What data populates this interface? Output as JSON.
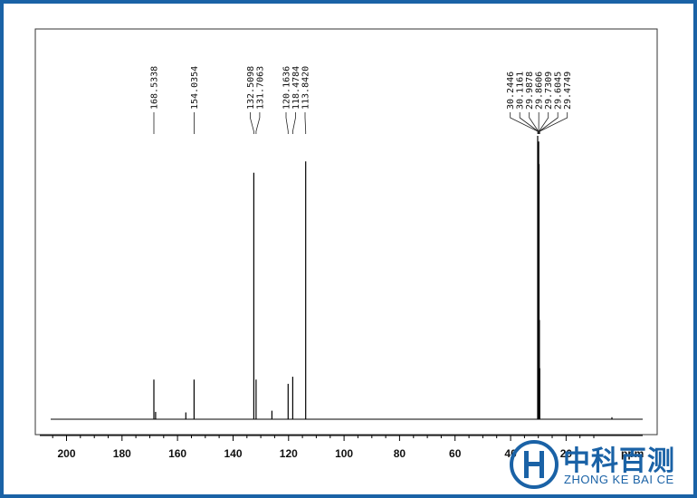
{
  "chart_data": {
    "type": "line",
    "title": "",
    "xlabel": "ppm",
    "ylabel": "",
    "x_reversed": true,
    "xlim": [
      206,
      0
    ],
    "ylim": [
      0,
      100
    ],
    "x_ticks": [
      200,
      180,
      160,
      140,
      120,
      100,
      80,
      60,
      40,
      20
    ],
    "peaks": [
      {
        "x": 168.53,
        "y": 14.0
      },
      {
        "x": 167.9,
        "y": 2.6
      },
      {
        "x": 157.0,
        "y": 2.4
      },
      {
        "x": 154.04,
        "y": 14.0
      },
      {
        "x": 132.51,
        "y": 87.0
      },
      {
        "x": 131.71,
        "y": 14.0
      },
      {
        "x": 126.0,
        "y": 3.0
      },
      {
        "x": 120.16,
        "y": 12.5
      },
      {
        "x": 118.48,
        "y": 15.0
      },
      {
        "x": 113.84,
        "y": 91.0
      },
      {
        "x": 30.24,
        "y": 100.0
      },
      {
        "x": 30.12,
        "y": 93.0
      },
      {
        "x": 29.99,
        "y": 96.0
      },
      {
        "x": 29.86,
        "y": 98.0
      },
      {
        "x": 29.73,
        "y": 90.0
      },
      {
        "x": 29.6,
        "y": 35.0
      },
      {
        "x": 29.47,
        "y": 18.0
      },
      {
        "x": 3.5,
        "y": 0.7
      }
    ],
    "peak_labels": [
      {
        "text": "168.5338",
        "x": 168.53
      },
      {
        "text": "154.0354",
        "x": 154.04
      },
      {
        "text": "132.5098",
        "x": 132.51
      },
      {
        "text": "131.7063",
        "x": 131.71
      },
      {
        "text": "120.1636",
        "x": 120.16
      },
      {
        "text": "118.4784",
        "x": 118.48
      },
      {
        "text": "113.8420",
        "x": 113.84
      },
      {
        "text": "30.2446",
        "x": 30.24
      },
      {
        "text": "30.1161",
        "x": 30.12
      },
      {
        "text": "29.9878",
        "x": 29.99
      },
      {
        "text": "29.8606",
        "x": 29.86
      },
      {
        "text": "29.7309",
        "x": 29.73
      },
      {
        "text": "29.6045",
        "x": 29.6
      },
      {
        "text": "29.4749",
        "x": 29.47
      }
    ]
  },
  "logo": {
    "text_cn": "中科百测",
    "text_en": "ZHONG KE BAI CE",
    "color": "#1a62a6"
  },
  "colors": {
    "frame": "#1a62a6",
    "trace": "#000000"
  }
}
